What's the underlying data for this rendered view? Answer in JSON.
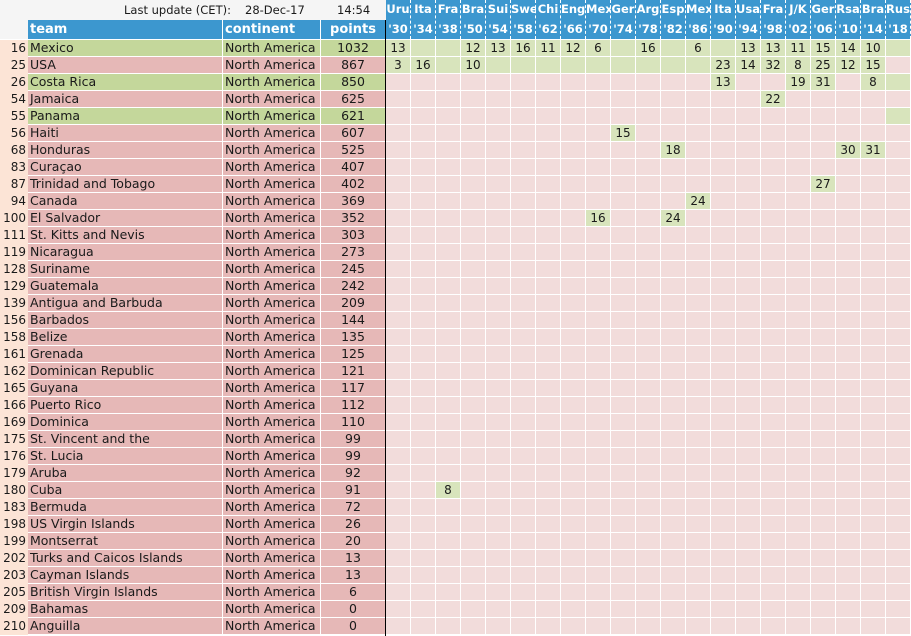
{
  "header": {
    "update_label": "Last update (CET):",
    "update_date": "28-Dec-17",
    "update_time": "14:54"
  },
  "columns": {
    "team": "team",
    "continent": "continent",
    "points": "points"
  },
  "world_cups": [
    {
      "host": "Uru",
      "year": "'30"
    },
    {
      "host": "Ita",
      "year": "'34"
    },
    {
      "host": "Fra",
      "year": "'38"
    },
    {
      "host": "Bra",
      "year": "'50"
    },
    {
      "host": "Sui",
      "year": "'54"
    },
    {
      "host": "Swe",
      "year": "'58"
    },
    {
      "host": "Chi",
      "year": "'62"
    },
    {
      "host": "Eng",
      "year": "'66"
    },
    {
      "host": "Mex",
      "year": "'70"
    },
    {
      "host": "Ger",
      "year": "'74"
    },
    {
      "host": "Arg",
      "year": "'78"
    },
    {
      "host": "Esp",
      "year": "'82"
    },
    {
      "host": "Mex",
      "year": "'86"
    },
    {
      "host": "Ita",
      "year": "'90"
    },
    {
      "host": "Usa",
      "year": "'94"
    },
    {
      "host": "Fra",
      "year": "'98"
    },
    {
      "host": "J/K",
      "year": "'02"
    },
    {
      "host": "Ger",
      "year": "'06"
    },
    {
      "host": "Rsa",
      "year": "'10"
    },
    {
      "host": "Bra",
      "year": "'14"
    },
    {
      "host": "Rus",
      "year": "'18"
    }
  ],
  "colors": {
    "header_blue": "#3c97cf",
    "qualified_row": "#c4d79b",
    "not_qualified_row": "#e6b8b7",
    "participation_cell": "#d8e4bc",
    "empty_cell": "#f2dcdb",
    "rank_bg": "#fce4d6"
  },
  "rows": [
    {
      "rank": "16",
      "team": "Mexico",
      "continent": "North America",
      "points": "1032",
      "qualified_2018": true,
      "results": [
        "13",
        "",
        "",
        "12",
        "13",
        "16",
        "11",
        "12",
        "6",
        "",
        "16",
        "",
        "6",
        "",
        "13",
        "13",
        "11",
        "15",
        "14",
        "10",
        ""
      ]
    },
    {
      "rank": "25",
      "team": "USA",
      "continent": "North America",
      "points": "867",
      "qualified_2018": false,
      "results": [
        "3",
        "16",
        "",
        "10",
        "",
        "",
        "",
        "",
        "",
        "",
        "",
        "",
        "",
        "23",
        "14",
        "32",
        "8",
        "25",
        "12",
        "15",
        null
      ]
    },
    {
      "rank": "26",
      "team": "Costa Rica",
      "continent": "North America",
      "points": "850",
      "qualified_2018": true,
      "results": [
        null,
        null,
        null,
        null,
        null,
        null,
        null,
        null,
        null,
        null,
        null,
        null,
        null,
        "13",
        null,
        null,
        "19",
        "31",
        null,
        "8",
        ""
      ]
    },
    {
      "rank": "54",
      "team": "Jamaica",
      "continent": "North America",
      "points": "625",
      "qualified_2018": false,
      "results": [
        null,
        null,
        null,
        null,
        null,
        null,
        null,
        null,
        null,
        null,
        null,
        null,
        null,
        null,
        null,
        "22",
        null,
        null,
        null,
        null,
        null
      ]
    },
    {
      "rank": "55",
      "team": "Panama",
      "continent": "North America",
      "points": "621",
      "qualified_2018": true,
      "results": [
        null,
        null,
        null,
        null,
        null,
        null,
        null,
        null,
        null,
        null,
        null,
        null,
        null,
        null,
        null,
        null,
        null,
        null,
        null,
        null,
        ""
      ]
    },
    {
      "rank": "56",
      "team": "Haiti",
      "continent": "North America",
      "points": "607",
      "qualified_2018": false,
      "results": [
        null,
        null,
        null,
        null,
        null,
        null,
        null,
        null,
        null,
        "15",
        null,
        null,
        null,
        null,
        null,
        null,
        null,
        null,
        null,
        null,
        null
      ]
    },
    {
      "rank": "68",
      "team": "Honduras",
      "continent": "North America",
      "points": "525",
      "qualified_2018": false,
      "results": [
        null,
        null,
        null,
        null,
        null,
        null,
        null,
        null,
        null,
        null,
        null,
        "18",
        null,
        null,
        null,
        null,
        null,
        null,
        "30",
        "31",
        null
      ]
    },
    {
      "rank": "83",
      "team": "Curaçao",
      "continent": "North America",
      "points": "407",
      "qualified_2018": false,
      "results": []
    },
    {
      "rank": "87",
      "team": "Trinidad and Tobago",
      "continent": "North America",
      "points": "402",
      "qualified_2018": false,
      "results": [
        null,
        null,
        null,
        null,
        null,
        null,
        null,
        null,
        null,
        null,
        null,
        null,
        null,
        null,
        null,
        null,
        null,
        "27",
        null,
        null,
        null
      ]
    },
    {
      "rank": "94",
      "team": "Canada",
      "continent": "North America",
      "points": "369",
      "qualified_2018": false,
      "results": [
        null,
        null,
        null,
        null,
        null,
        null,
        null,
        null,
        null,
        null,
        null,
        null,
        "24",
        null,
        null,
        null,
        null,
        null,
        null,
        null,
        null
      ]
    },
    {
      "rank": "100",
      "team": "El Salvador",
      "continent": "North America",
      "points": "352",
      "qualified_2018": false,
      "results": [
        null,
        null,
        null,
        null,
        null,
        null,
        null,
        null,
        "16",
        null,
        null,
        "24",
        null,
        null,
        null,
        null,
        null,
        null,
        null,
        null,
        null
      ]
    },
    {
      "rank": "111",
      "team": "St. Kitts and Nevis",
      "continent": "North America",
      "points": "303",
      "qualified_2018": false,
      "results": []
    },
    {
      "rank": "119",
      "team": "Nicaragua",
      "continent": "North America",
      "points": "273",
      "qualified_2018": false,
      "results": []
    },
    {
      "rank": "128",
      "team": "Suriname",
      "continent": "North America",
      "points": "245",
      "qualified_2018": false,
      "results": []
    },
    {
      "rank": "129",
      "team": "Guatemala",
      "continent": "North America",
      "points": "242",
      "qualified_2018": false,
      "results": []
    },
    {
      "rank": "139",
      "team": "Antigua and Barbuda",
      "continent": "North America",
      "points": "209",
      "qualified_2018": false,
      "results": []
    },
    {
      "rank": "156",
      "team": "Barbados",
      "continent": "North America",
      "points": "144",
      "qualified_2018": false,
      "results": []
    },
    {
      "rank": "158",
      "team": "Belize",
      "continent": "North America",
      "points": "135",
      "qualified_2018": false,
      "results": []
    },
    {
      "rank": "161",
      "team": "Grenada",
      "continent": "North America",
      "points": "125",
      "qualified_2018": false,
      "results": []
    },
    {
      "rank": "162",
      "team": "Dominican Republic",
      "continent": "North America",
      "points": "121",
      "qualified_2018": false,
      "results": []
    },
    {
      "rank": "165",
      "team": "Guyana",
      "continent": "North America",
      "points": "117",
      "qualified_2018": false,
      "results": []
    },
    {
      "rank": "166",
      "team": "Puerto Rico",
      "continent": "North America",
      "points": "112",
      "qualified_2018": false,
      "results": []
    },
    {
      "rank": "169",
      "team": "Dominica",
      "continent": "North America",
      "points": "110",
      "qualified_2018": false,
      "results": []
    },
    {
      "rank": "175",
      "team": "St. Vincent and the Grenadines",
      "continent": "North America",
      "points": "99",
      "qualified_2018": false,
      "results": []
    },
    {
      "rank": "176",
      "team": "St. Lucia",
      "continent": "North America",
      "points": "99",
      "qualified_2018": false,
      "results": []
    },
    {
      "rank": "179",
      "team": "Aruba",
      "continent": "North America",
      "points": "92",
      "qualified_2018": false,
      "results": []
    },
    {
      "rank": "180",
      "team": "Cuba",
      "continent": "North America",
      "points": "91",
      "qualified_2018": false,
      "results": [
        null,
        null,
        "8",
        null,
        null,
        null,
        null,
        null,
        null,
        null,
        null,
        null,
        null,
        null,
        null,
        null,
        null,
        null,
        null,
        null,
        null
      ]
    },
    {
      "rank": "183",
      "team": "Bermuda",
      "continent": "North America",
      "points": "72",
      "qualified_2018": false,
      "results": []
    },
    {
      "rank": "198",
      "team": "US Virgin Islands",
      "continent": "North America",
      "points": "26",
      "qualified_2018": false,
      "results": []
    },
    {
      "rank": "199",
      "team": "Montserrat",
      "continent": "North America",
      "points": "20",
      "qualified_2018": false,
      "results": []
    },
    {
      "rank": "202",
      "team": "Turks and Caicos Islands",
      "continent": "North America",
      "points": "13",
      "qualified_2018": false,
      "results": []
    },
    {
      "rank": "203",
      "team": "Cayman Islands",
      "continent": "North America",
      "points": "13",
      "qualified_2018": false,
      "results": []
    },
    {
      "rank": "205",
      "team": "British Virgin Islands",
      "continent": "North America",
      "points": "6",
      "qualified_2018": false,
      "results": []
    },
    {
      "rank": "209",
      "team": "Bahamas",
      "continent": "North America",
      "points": "0",
      "qualified_2018": false,
      "results": []
    },
    {
      "rank": "210",
      "team": "Anguilla",
      "continent": "North America",
      "points": "0",
      "qualified_2018": false,
      "results": []
    }
  ]
}
